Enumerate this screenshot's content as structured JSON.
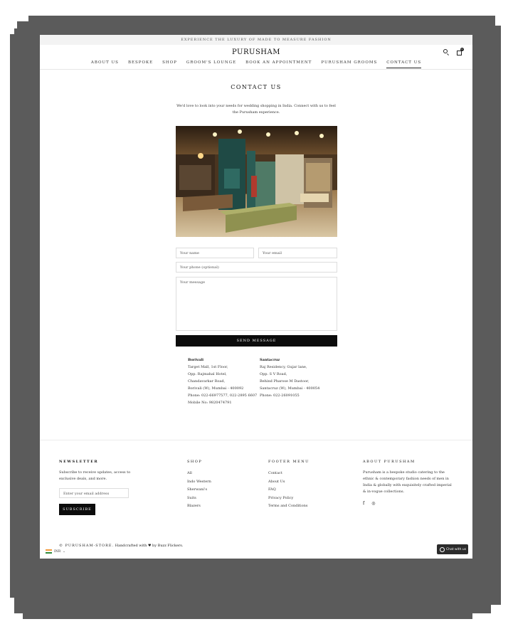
{
  "announcement": "EXPERIENCE THE LUXURY OF MADE TO MEASURE FASHION",
  "header": {
    "logo": "PURUSHAM",
    "cart_count": "0",
    "nav": [
      "ABOUT US",
      "BESPOKE",
      "SHOP",
      "GROOM'S LOUNGE",
      "BOOK AN APPOINTMENT",
      "PURUSHAM GROOMS",
      "CONTACT US"
    ],
    "active_nav": "CONTACT US"
  },
  "contact": {
    "title": "CONTACT US",
    "intro": "We'd love to look into your needs for wedding shopping in India. Connect with us to feel the Purusham experience.",
    "form": {
      "name_placeholder": "Your name",
      "email_placeholder": "Your email",
      "phone_placeholder": "Your phone (optional)",
      "message_placeholder": "Your message",
      "send_label": "SEND MESSAGE"
    },
    "stores": [
      {
        "city": "Borivali",
        "lines": [
          "Target Mall, 1st Floor,",
          "Opp. Rajmahal Hotel,",
          "Chandavarkar Road,",
          "Borivali (W), Mumbai - 400092",
          "Phone: 022-66977577, 022-2895 6607",
          "Mobile No: 9820474791"
        ]
      },
      {
        "city": "Santacruz",
        "lines": [
          "Raj Residency, Gujar lane,",
          "Opp. S V Road,",
          "Behind Pharose M Dastoor,",
          "Santacruz (W), Mumbai - 400054",
          "Phone: 022-26091055"
        ]
      }
    ]
  },
  "footer": {
    "newsletter": {
      "heading": "NEWSLETTER",
      "text": "Subscribe to receive updates, access to exclusive deals, and more.",
      "email_placeholder": "Enter your email address",
      "subscribe_label": "SUBSCRIBE"
    },
    "shop": {
      "heading": "SHOP",
      "links": [
        "All",
        "Indo Western",
        "Sherwani's",
        "Suits",
        "Blazers"
      ]
    },
    "menu": {
      "heading": "FOOTER MENU",
      "links": [
        "Contact",
        "About Us",
        "FAQ",
        "Privacy Policy",
        "Terms and Conditions"
      ]
    },
    "about": {
      "heading": "ABOUT PURUSHAM",
      "text": "Purusham is a bespoke studio catering to the ethnic & contemporary fashion needs of men in India & globally with exquisitely crafted imperial & in-vogue collections.",
      "socials": [
        "facebook-icon",
        "instagram-icon"
      ]
    },
    "copyright_brand": "© PURUSHAM-STORE.",
    "copyright_text": "Handcrafted with ♥ by Buzz Flickers.",
    "currency": "INR",
    "chat_label": "Chat with us"
  },
  "colors": {
    "frame": "#5b5b5b",
    "button": "#0c0c0c",
    "chat": "#2b2b2b"
  }
}
